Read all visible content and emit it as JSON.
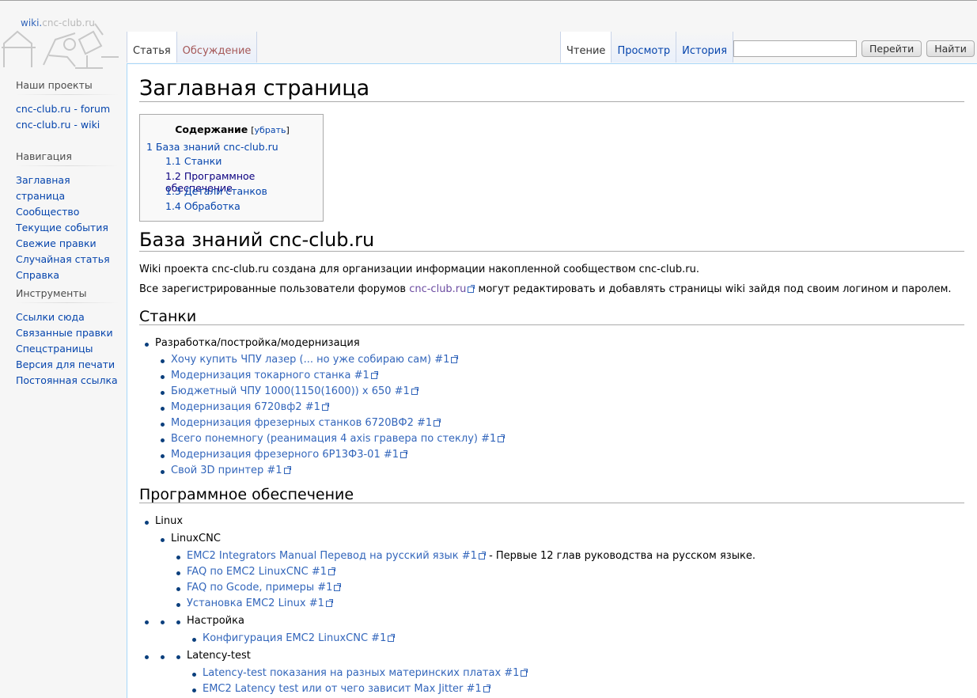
{
  "logo": {
    "text_a": "wiki.",
    "text_b": "cnc-club.ru"
  },
  "sidebar": {
    "projects": {
      "title": "Наши проекты",
      "items": [
        "cnc-club.ru - forum",
        "cnc-club.ru - wiki"
      ]
    },
    "navigation": {
      "title": "Навигация",
      "items": [
        "Заглавная страница",
        "Сообщество",
        "Текущие события",
        "Свежие правки",
        "Случайная статья",
        "Справка"
      ]
    },
    "tools": {
      "title": "Инструменты",
      "items": [
        "Ссылки сюда",
        "Связанные правки",
        "Спецстраницы",
        "Версия для печати",
        "Постоянная ссылка"
      ]
    }
  },
  "tabs": {
    "left": [
      "Статья",
      "Обсуждение"
    ],
    "right": [
      "Чтение",
      "Просмотр",
      "История"
    ]
  },
  "search": {
    "value": "",
    "go": "Перейти",
    "find": "Найти"
  },
  "page": {
    "title": "Заглавная страница",
    "toc": {
      "title": "Содержание",
      "hide_open": "[",
      "hide": "убрать",
      "hide_close": "]",
      "items": [
        "1 База знаний cnc-club.ru",
        "1.1 Станки",
        "1.2 Программное обеспечение",
        "1.3 Детали станков",
        "1.4 Обработка"
      ]
    },
    "h_main": "База знаний cnc-club.ru",
    "p1": "Wiki проекта cnc-club.ru создана для организации информации накопленной сообществом cnc-club.ru.",
    "p2_before": "Все зарегистрированные пользователи форумов ",
    "p2_link": "cnc-club.ru",
    "p2_after": " могут редактировать и добавлять страницы wiki зайдя под своим логином и паролем.",
    "h_stanki": "Станки",
    "stanki_group": "Разработка/постройка/модернизация",
    "stanki_links": [
      "Хочу купить ЧПУ лазер (... но уже собираю сам) #1",
      "Модернизация токарного станка #1",
      "Бюджетный ЧПУ 1000(1150(1600)) x 650 #1",
      "Модернизация 6720вф2 #1",
      "Модернизация фрезерных станков 6720ВФ2 #1",
      "Всего понемногу (реанимация 4 axis гравера по стеклу) #1",
      "Модернизация фрезерного 6Р13Ф3-01 #1",
      "Свой 3D принтер #1"
    ],
    "h_software": "Программное обеспечение",
    "sw_linux": "Linux",
    "sw_linuxcnc": "LinuxCNC",
    "sw_links": [
      "EMC2 Integrators Manual Перевод на русский язык #1",
      "FAQ по EMC2 LinuxCNC #1",
      "FAQ по Gcode, примеры #1",
      "Установка EMC2 Linux #1"
    ],
    "sw_manual_note": " - Первые 12 глав руководства на русском языке.",
    "sw_setup": "Настройка",
    "sw_setup_link": "Конфигурация EMC2 LinuxCNC #1",
    "sw_latency": "Latency-test",
    "sw_latency_links": [
      "Latency-test показания на разных материнских платах #1",
      "EMC2 Latency test или от чего зависит Max Jitter #1"
    ]
  }
}
